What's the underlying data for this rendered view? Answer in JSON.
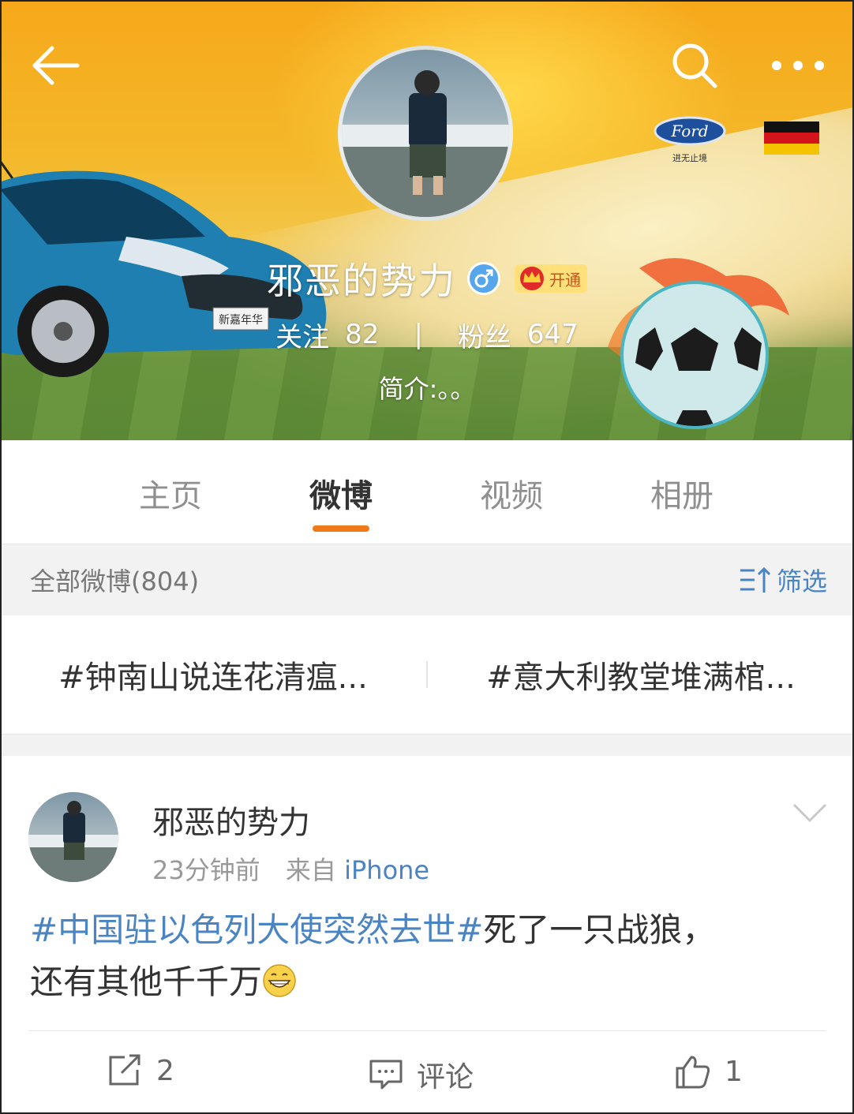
{
  "header": {
    "back_icon": "back-arrow-icon",
    "search_icon": "search-icon",
    "more_icon": "more-dots-icon",
    "ford_brand": "Ford",
    "ford_slogan": "进无止境",
    "car_plate": "新嘉年华"
  },
  "profile": {
    "name": "邪恶的势力",
    "gender_icon": "male-icon",
    "vip_label": "开通",
    "following_label": "关注",
    "following_count": "82",
    "separator": "|",
    "followers_label": "粉丝",
    "followers_count": "647",
    "bio": "简介:。。"
  },
  "tabs": [
    {
      "label": "主页"
    },
    {
      "label": "微博"
    },
    {
      "label": "视频"
    },
    {
      "label": "相册"
    }
  ],
  "active_tab_color": "#f07a18",
  "filter_bar": {
    "count_label": "全部微博(804)",
    "filter_label": "筛选"
  },
  "topics": [
    {
      "label": "#钟南山说连花清瘟..."
    },
    {
      "label": "#意大利教堂堆满棺..."
    }
  ],
  "post": {
    "author": "邪恶的势力",
    "time": "23分钟前",
    "from_prefix": "来自",
    "source": "iPhone",
    "hashtag": "#中国驻以色列大使突然去世#",
    "text_part1": "死了一只战狼，",
    "text_part2": "还有其他千千万",
    "emoji": "grin-emoji",
    "repost_count": "2",
    "comment_label": "评论",
    "like_count": "1"
  },
  "colors": {
    "link": "#4a84c2",
    "accent": "#f07a18"
  }
}
